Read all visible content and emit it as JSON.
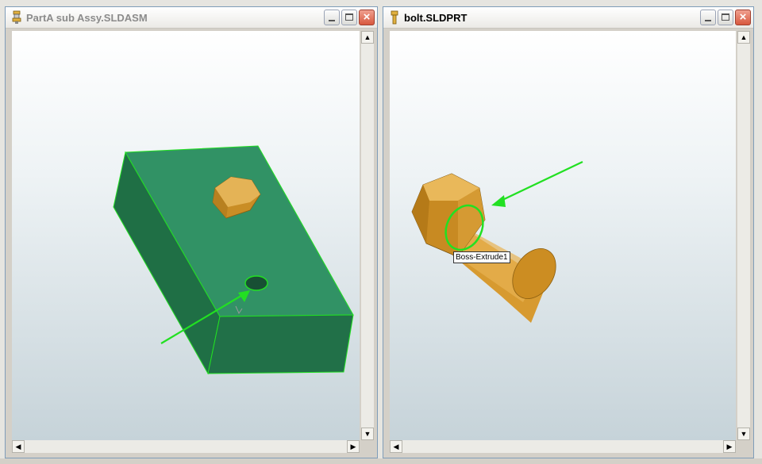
{
  "windows": {
    "assembly": {
      "title": "PartA sub Assy.SLDASM",
      "title_icon": "assembly-icon",
      "active": false
    },
    "part": {
      "title": "bolt.SLDPRT",
      "title_icon": "part-icon",
      "active": true,
      "callout_label": "Boss-Extrude1"
    }
  },
  "colors": {
    "block_green": "#2e8b57",
    "bolt_gold": "#d9a441",
    "highlight_green": "#22e022"
  }
}
